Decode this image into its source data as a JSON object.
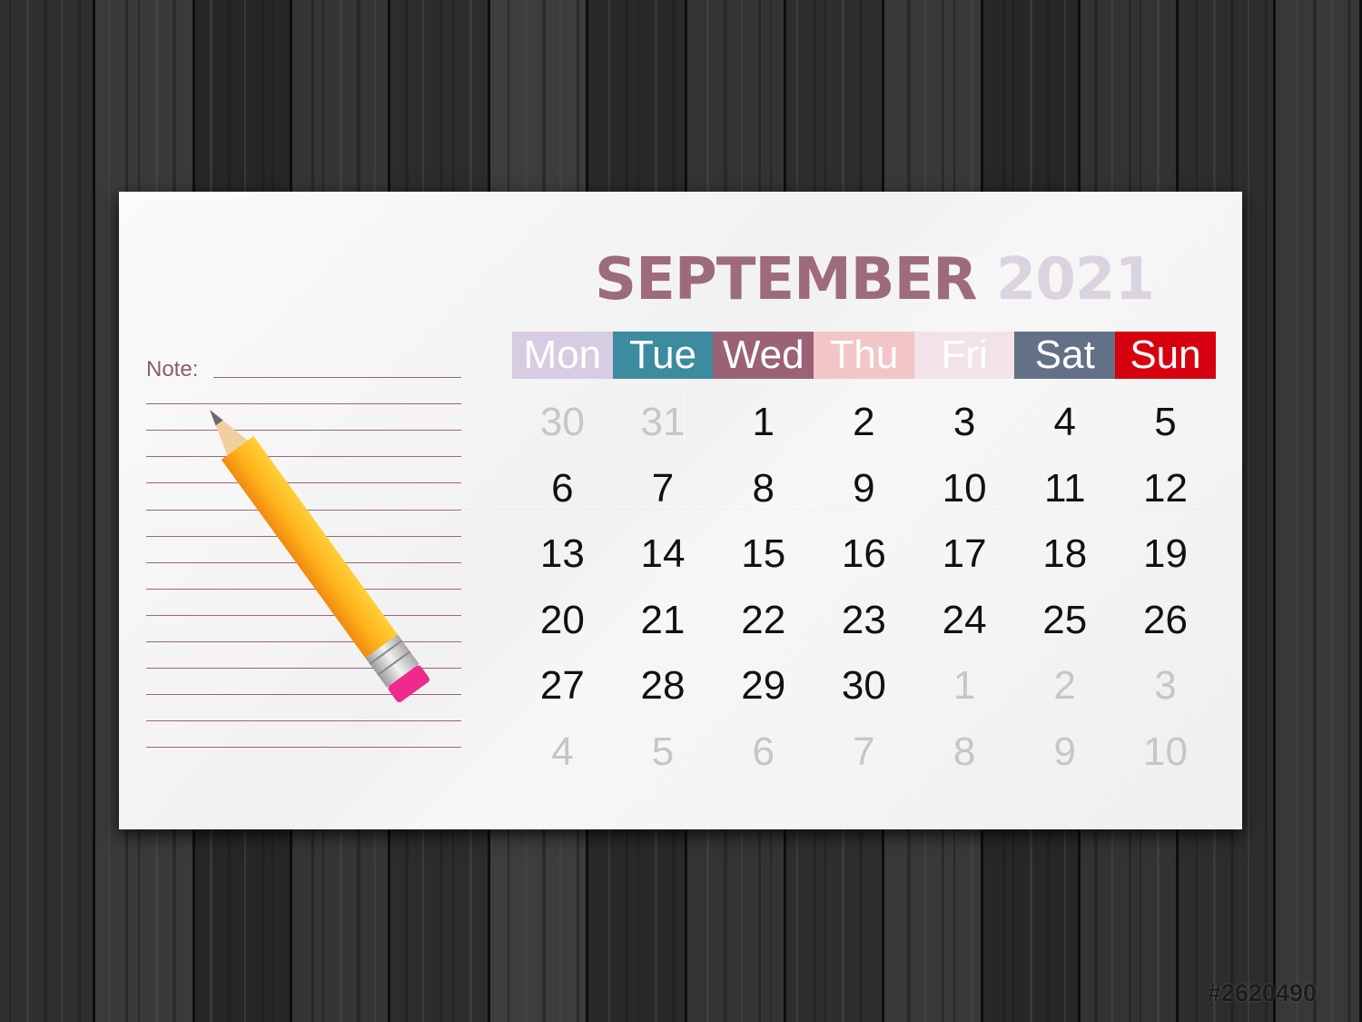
{
  "calendar": {
    "month": "SEPTEMBER",
    "year": "2021",
    "weekdays": [
      {
        "label": "Mon",
        "color": "#d7cce1"
      },
      {
        "label": "Tue",
        "color": "#3c8b9f"
      },
      {
        "label": "Wed",
        "color": "#9b6276"
      },
      {
        "label": "Thu",
        "color": "#f2c6c7"
      },
      {
        "label": "Fri",
        "color": "#f2e3ea"
      },
      {
        "label": "Sat",
        "color": "#627186"
      },
      {
        "label": "Sun",
        "color": "#d6000f"
      }
    ],
    "weeks": [
      [
        {
          "d": "30",
          "m": true
        },
        {
          "d": "31",
          "m": true
        },
        {
          "d": "1"
        },
        {
          "d": "2"
        },
        {
          "d": "3"
        },
        {
          "d": "4"
        },
        {
          "d": "5"
        }
      ],
      [
        {
          "d": "6"
        },
        {
          "d": "7"
        },
        {
          "d": "8"
        },
        {
          "d": "9"
        },
        {
          "d": "10"
        },
        {
          "d": "11"
        },
        {
          "d": "12"
        }
      ],
      [
        {
          "d": "13"
        },
        {
          "d": "14"
        },
        {
          "d": "15"
        },
        {
          "d": "16"
        },
        {
          "d": "17"
        },
        {
          "d": "18"
        },
        {
          "d": "19"
        }
      ],
      [
        {
          "d": "20"
        },
        {
          "d": "21"
        },
        {
          "d": "22"
        },
        {
          "d": "23"
        },
        {
          "d": "24"
        },
        {
          "d": "25"
        },
        {
          "d": "26"
        }
      ],
      [
        {
          "d": "27"
        },
        {
          "d": "28"
        },
        {
          "d": "29"
        },
        {
          "d": "30"
        },
        {
          "d": "1",
          "m": true
        },
        {
          "d": "2",
          "m": true
        },
        {
          "d": "3",
          "m": true
        }
      ],
      [
        {
          "d": "4",
          "m": true
        },
        {
          "d": "5",
          "m": true
        },
        {
          "d": "6",
          "m": true
        },
        {
          "d": "7",
          "m": true
        },
        {
          "d": "8",
          "m": true
        },
        {
          "d": "9",
          "m": true
        },
        {
          "d": "10",
          "m": true
        }
      ]
    ]
  },
  "notes": {
    "label": "Note:",
    "line_color": "#9a6677",
    "line_count": 15
  },
  "stock_id": "#2620490",
  "colors": {
    "month_title": "#9d6a7e",
    "year_title": "#dcd3e0",
    "date_text": "#111111",
    "muted_date_text": "#c6c6c6"
  },
  "icons": [
    "pencil-icon"
  ]
}
